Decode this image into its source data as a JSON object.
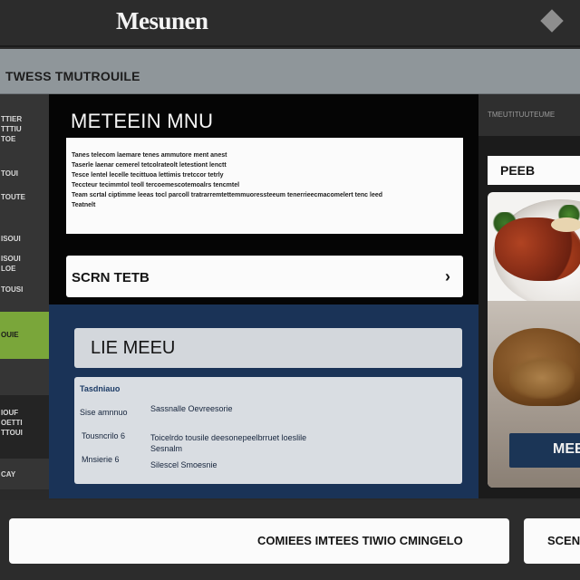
{
  "header": {
    "app_title": "Mesunen",
    "menu_icon": "diamond-icon"
  },
  "subheader": {
    "title": "TWESS TMUTROUILE"
  },
  "sidebar": {
    "items": [
      {
        "label": "TTIER\nTTTIU\nTOE"
      },
      {
        "label": "TOUI"
      },
      {
        "label": "TOUTE"
      },
      {
        "label": "ISOUI"
      },
      {
        "label": "ISOUI\nLOE"
      },
      {
        "label": "TOUSI"
      },
      {
        "label": "OUIE"
      },
      {
        "label": "IOUF\nOETTI\nTTOUI"
      },
      {
        "label": "CAY"
      }
    ]
  },
  "main_panel": {
    "title": "METEEIN MNU",
    "description_lines": [
      "Tanes telecom laemare tenes ammutore ment anest",
      "Taserle laenar cemerel tetcolrateolt letestiont lenctt",
      "Tesce lentel lecelle tecittuoa lettimis tretccor tetrly",
      "Teccteur tecimmtol teoll tercoemescotemoalrs tencmtel",
      "Team scrtal ciptimme leeas tocl parcoll tratrarremtettemmuoressteeum tenerrieecmacomelert tenc leed",
      "Teatnelt"
    ],
    "search_label": "SCRN TETB",
    "search_chevron": "chevron-right-icon"
  },
  "menu_section": {
    "title": "LIE MEEU",
    "card_heading": "Tasdniauo",
    "rows": [
      {
        "label": "Sise amnnuo",
        "value": "Sassnalle Oevreesorie"
      },
      {
        "label": "Tousncrilo 6",
        "value": "Toicelrdo tousile deesonepeelbrruet loeslile"
      },
      {
        "label": "Mnsierie 6",
        "value": "Sesnalm"
      }
    ],
    "card_footer": "Silescel Smoesnie"
  },
  "right_panel": {
    "tab_label": "TMEUTITUUTEUME",
    "pref_label": "PEEB",
    "food_button_label": "MEE"
  },
  "footer": {
    "primary_button": "COMIEES IMTEES TIWIO CMINGELO",
    "secondary_button": "SCEN"
  }
}
